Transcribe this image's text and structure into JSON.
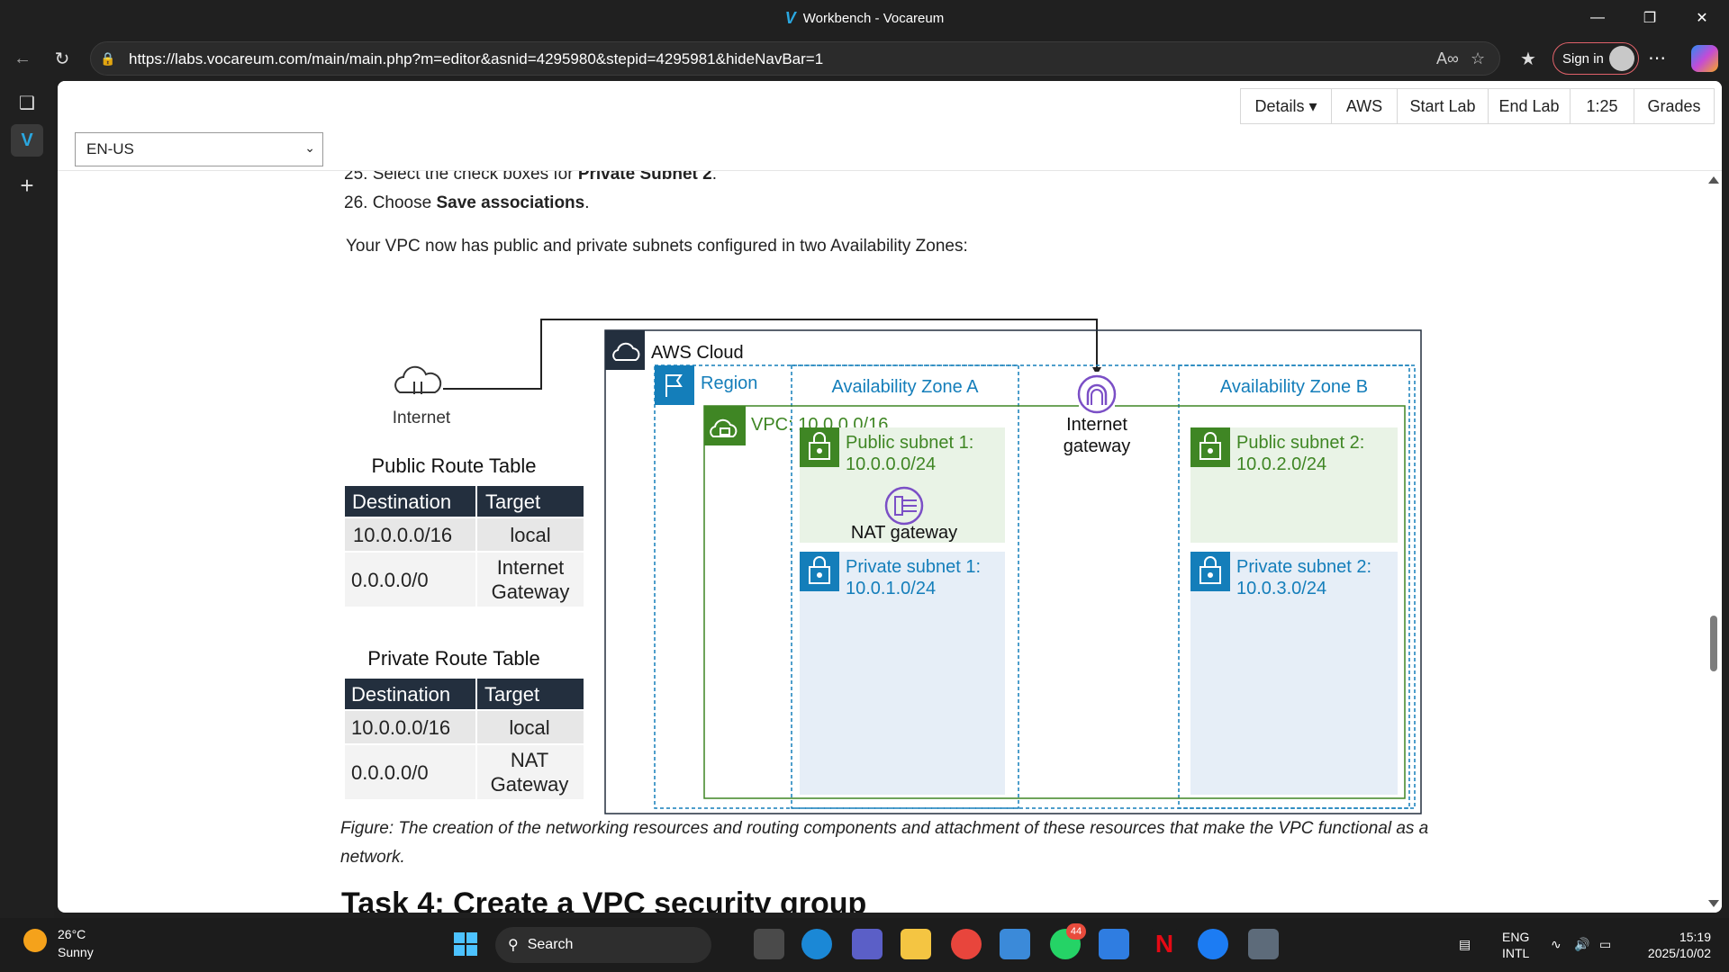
{
  "window": {
    "title": "Workbench - Vocareum"
  },
  "browser": {
    "url": "https://labs.vocareum.com/main/main.php?m=editor&asnid=4295980&stepid=4295981&hideNavBar=1",
    "signin_label": "Sign in"
  },
  "labbar": {
    "buttons": [
      "Details ▾",
      "AWS",
      "Start Lab",
      "End Lab",
      "1:25",
      "Grades"
    ],
    "language": "EN-US"
  },
  "content": {
    "step25_prefix": "25. Select the check boxes for ",
    "step25_bold": "Private Subnet 2",
    "step25_suffix": ".",
    "step26_prefix": "26. Choose ",
    "step26_bold": "Save associations",
    "step26_suffix": ".",
    "summary": "Your VPC now has public and private subnets configured in two Availability Zones:",
    "caption": "Figure: The creation of the networking resources and routing components and attachment of these resources that make the VPC functional as a network.",
    "next_heading": "Task 4: Create a VPC security group"
  },
  "diagram": {
    "internet_label": "Internet",
    "aws_cloud_label": "AWS Cloud",
    "region_label": "Region",
    "vpc_label": "VPC: 10.0.0.0/16",
    "az_a_label": "Availability Zone A",
    "az_b_label": "Availability Zone B",
    "igw_line1": "Internet",
    "igw_line2": "gateway",
    "public_subnet_1_line1": "Public subnet 1:",
    "public_subnet_1_line2": "10.0.0.0/24",
    "nat_gateway_label": "NAT gateway",
    "private_subnet_1_line1": "Private subnet 1:",
    "private_subnet_1_line2": "10.0.1.0/24",
    "public_subnet_2_line1": "Public subnet 2:",
    "public_subnet_2_line2": "10.0.2.0/24",
    "private_subnet_2_line1": "Private subnet 2:",
    "private_subnet_2_line2": "10.0.3.0/24",
    "public_route_table": {
      "title": "Public Route Table",
      "headers": [
        "Destination",
        "Target"
      ],
      "rows": [
        [
          "10.0.0.0/16",
          "local"
        ],
        [
          "0.0.0.0/0",
          "Internet",
          "Gateway"
        ]
      ]
    },
    "private_route_table": {
      "title": "Private Route Table",
      "headers": [
        "Destination",
        "Target"
      ],
      "rows": [
        [
          "10.0.0.0/16",
          "local"
        ],
        [
          "0.0.0.0/0",
          "NAT",
          "Gateway"
        ]
      ]
    },
    "colors": {
      "header_dark": "#232f3e",
      "cell_gray": "#e7e7e7",
      "region_blue": "#147eba",
      "vpc_green": "#3f8624",
      "public_fill": "#e9f3e6",
      "private_fill": "#e6eef7",
      "purple": "#7b4fc6"
    }
  },
  "taskbar": {
    "temperature": "26°C",
    "condition": "Sunny",
    "search_label": "Search",
    "badge": "44",
    "lang_line1": "ENG",
    "lang_line2": "INTL",
    "time": "15:19",
    "date": "2025/10/02"
  }
}
